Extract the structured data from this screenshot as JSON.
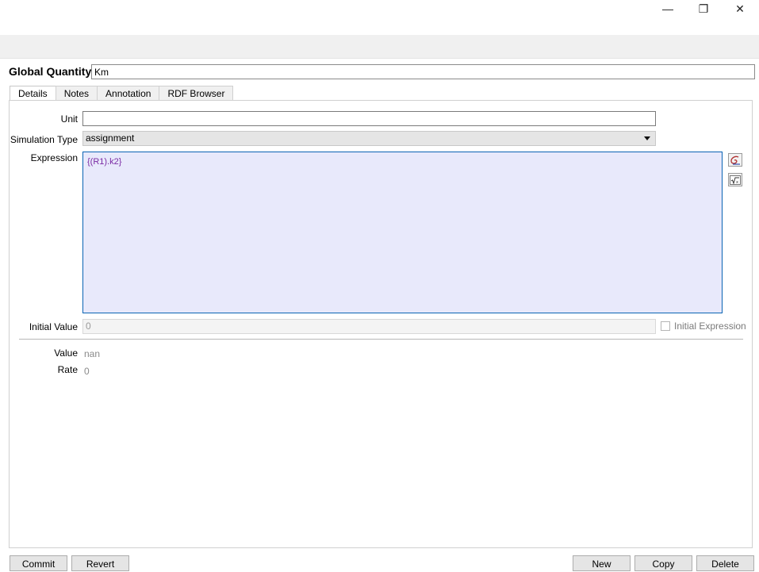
{
  "window": {
    "controls": {
      "minimize": "—",
      "maximize": "❐",
      "close": "✕"
    }
  },
  "header": {
    "label": "Global Quantity",
    "name_value": "Km"
  },
  "tabs": [
    {
      "label": "Details",
      "active": true
    },
    {
      "label": "Notes",
      "active": false
    },
    {
      "label": "Annotation",
      "active": false
    },
    {
      "label": "RDF Browser",
      "active": false
    }
  ],
  "details": {
    "unit_label": "Unit",
    "unit_value": "",
    "simulation_type_label": "Simulation Type",
    "simulation_type_value": "assignment",
    "expression_label": "Expression",
    "expression_value": "{(R1).k2}",
    "initial_value_label": "Initial Value",
    "initial_value": "0",
    "initial_expression_label": "Initial Expression",
    "initial_expression_checked": false,
    "value_label": "Value",
    "value": "nan",
    "rate_label": "Rate",
    "rate": "0"
  },
  "icons": {
    "object_browser": "object-browser-icon",
    "formula_view": "formula-view-icon"
  },
  "buttons": {
    "commit": "Commit",
    "revert": "Revert",
    "new": "New",
    "copy": "Copy",
    "delete": "Delete"
  },
  "colors": {
    "expression_background": "#e8e9fb",
    "expression_border": "#0a64b4",
    "expression_text": "#7a2aa4"
  }
}
